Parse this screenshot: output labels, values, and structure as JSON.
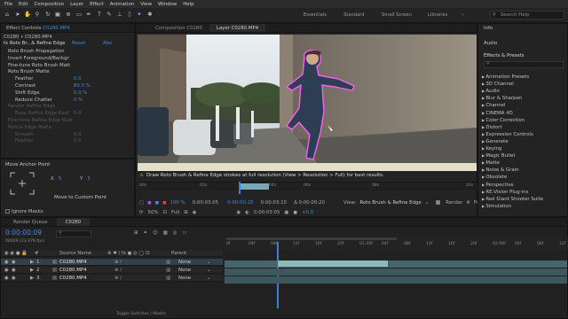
{
  "menu": [
    "File",
    "Edit",
    "Composition",
    "Layer",
    "Effect",
    "Animation",
    "View",
    "Window",
    "Help"
  ],
  "workspaces": [
    "Essentials",
    "Standard",
    "Small Screen",
    "Libraries"
  ],
  "search_placeholder": "Search Help",
  "project_tab": "C0280 • C0280.MP4",
  "effect_controls": {
    "tab": "Effect Controls",
    "tab_file": "C0280.MP4",
    "effect_name": "Roto Br...& Refine Edge",
    "reset": "Reset",
    "about": "Abo",
    "items": [
      {
        "label": "Roto Brush Propagation",
        "value": ""
      },
      {
        "label": "Invert Foreground/Backgr",
        "value": ""
      },
      {
        "label": "Fine-tune Roto Brush Matt",
        "value": ""
      },
      {
        "label": "Roto Brush Matte",
        "value": ""
      },
      {
        "label": "Feather",
        "value": "0.0"
      },
      {
        "label": "Contrast",
        "value": "80.0 %"
      },
      {
        "label": "Shift Edge",
        "value": "0.0 %"
      },
      {
        "label": "Reduce Chatter",
        "value": "0 %"
      },
      {
        "label": "Render Refine Edge",
        "value": ""
      },
      {
        "label": "Base Refine Edge Radi",
        "value": "5.0"
      },
      {
        "label": "Fine-tune Refine Edge Matt",
        "value": ""
      },
      {
        "label": "Refine Edge Matte",
        "value": ""
      },
      {
        "label": "Smooth",
        "value": "0.0"
      },
      {
        "label": "Feather",
        "value": "0.0"
      }
    ]
  },
  "move_anchor": {
    "title": "Move Anchor Point",
    "x_label": "X",
    "x_value": ".5",
    "y_label": "Y",
    "y_value": ".5",
    "button": "Move to Custom Point",
    "ignore_masks": "Ignore Masks"
  },
  "viewer": {
    "tab1": "Composition C0280",
    "tab2": "Layer C0280.MP4",
    "info_text": "Draw Roto Brush & Refine Edge strokes at full resolution (View > Resolution > Full) for best results.",
    "ruler_labels": [
      "00s",
      "02s",
      "04s",
      "06s",
      "08s",
      "10s"
    ],
    "zoom": "100 %",
    "time1": "0:00:03:05",
    "time2": "0:00:00:20",
    "time3": "0:00:03:15",
    "delta": "Δ 0:00:00:20",
    "delta2": "+0.0",
    "view_label": "View:",
    "view_value": "Roto Brush & Refine Edge",
    "render": "Render",
    "freeze": "Freeze",
    "zoom2": "50%",
    "res": "Full"
  },
  "right_panels": {
    "info": "Info",
    "audio": "Audio",
    "effects_title": "Effects & Presets",
    "effects": [
      "Animation Presets",
      "3D Channel",
      "Audio",
      "Blur & Sharpen",
      "Channel",
      "CINEMA 4D",
      "Color Correction",
      "Distort",
      "Expression Controls",
      "Generate",
      "Keying",
      "Magic Bullet",
      "Matte",
      "Noise & Grain",
      "Obsolete",
      "Perspective",
      "RE:Vision Plug-ins",
      "Red Giant Shooter Suite",
      "Simulation"
    ]
  },
  "timeline": {
    "tab_render": "Render Queue",
    "tab_comp": "C0280",
    "timecode": "0:00:00:09",
    "frames": "00009 (23.976 fps)",
    "col_source": "Source Name",
    "col_parent": "Parent",
    "layers": [
      {
        "num": "1",
        "name": "C0280.MP4",
        "parent": "None"
      },
      {
        "num": "2",
        "name": "C0280.MP4",
        "parent": "None"
      },
      {
        "num": "3",
        "name": "C0280.MP4",
        "parent": "None"
      }
    ],
    "ticks": [
      "0f",
      "04f",
      "08f",
      "12f",
      "16f",
      "20f",
      "01:00f",
      "04f",
      "08f",
      "12f",
      "16f",
      "20f",
      "02:00f",
      "04f",
      "08f",
      "12f"
    ],
    "footer": "Toggle Switches / Modes"
  }
}
